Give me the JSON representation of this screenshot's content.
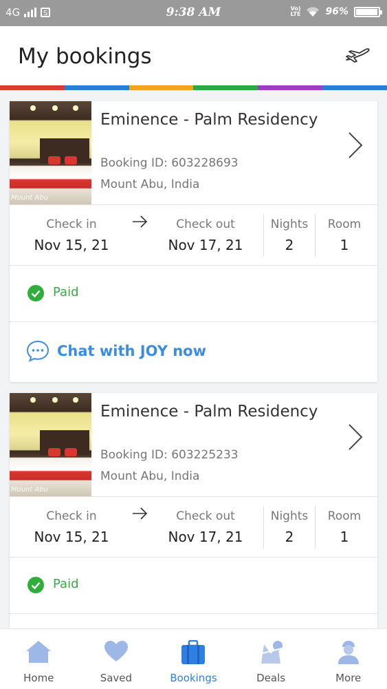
{
  "status_bar": {
    "network": "4G",
    "time": "9:38 AM",
    "battery": "96%"
  },
  "header": {
    "title": "My bookings"
  },
  "brand_colors": [
    "#d93b30",
    "#2a7fd4",
    "#f2a51a",
    "#2aa84a",
    "#9a3fc0",
    "#2a7fd4"
  ],
  "bookings": [
    {
      "hotel_name": "Eminence - Palm Residency",
      "booking_id": "Booking ID: 603228693",
      "location": "Mount Abu, India",
      "check_in_label": "Check in",
      "check_in": "Nov 15, 21",
      "check_out_label": "Check out",
      "check_out": "Nov 17, 21",
      "nights_label": "Nights",
      "nights": "2",
      "room_label": "Room",
      "rooms": "1",
      "status": "Paid",
      "chat": "Chat with JOY now",
      "thumb_watermark": "Mount Abu"
    },
    {
      "hotel_name": "Eminence - Palm Residency",
      "booking_id": "Booking ID: 603225233",
      "location": "Mount Abu, India",
      "check_in_label": "Check in",
      "check_in": "Nov 15, 21",
      "check_out_label": "Check out",
      "check_out": "Nov 17, 21",
      "nights_label": "Nights",
      "nights": "2",
      "room_label": "Room",
      "rooms": "1",
      "status": "Paid",
      "thumb_watermark": "Mount Abu"
    }
  ],
  "tabs": [
    {
      "label": "Home",
      "icon": "home-icon"
    },
    {
      "label": "Saved",
      "icon": "heart-icon"
    },
    {
      "label": "Bookings",
      "icon": "briefcase-icon",
      "active": true
    },
    {
      "label": "Deals",
      "icon": "deals-icon"
    },
    {
      "label": "More",
      "icon": "profile-icon"
    }
  ]
}
